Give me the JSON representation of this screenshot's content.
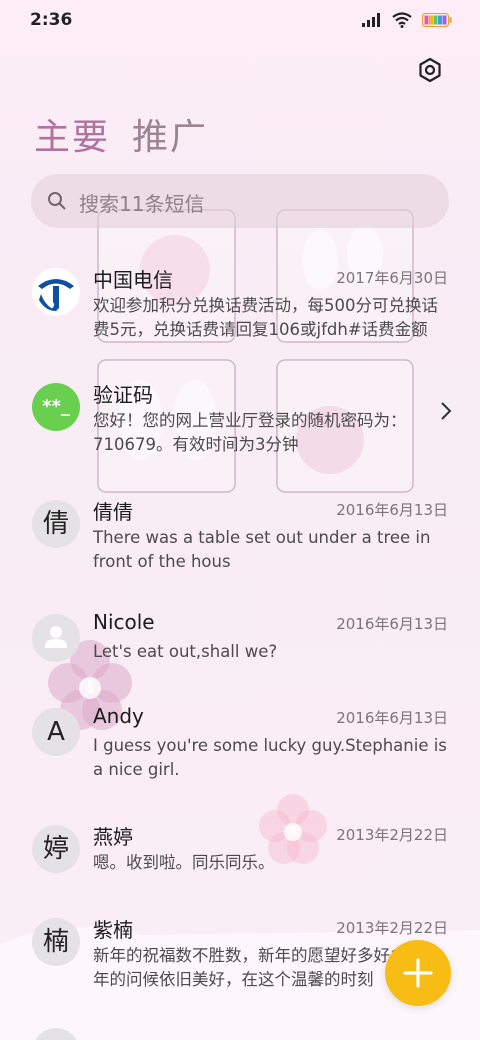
{
  "status_bar": {
    "time": "2:36",
    "icons": [
      "signal-icon",
      "wifi-icon",
      "battery-icon"
    ]
  },
  "header": {
    "settings_icon": "settings-hexagon-icon",
    "tabs": [
      {
        "label": "主要"
      },
      {
        "label": "推广"
      }
    ]
  },
  "search": {
    "placeholder": "搜索11条短信",
    "icon": "search-icon"
  },
  "messages": [
    {
      "sender": "中国电信",
      "avatar": "china-telecom-logo",
      "date": "2017年6月30日",
      "preview": "欢迎参加积分兑换话费活动，每500分可兑换话费5元，兑换话费请回复106或jfdh#话费金额"
    },
    {
      "sender": "验证码",
      "avatar": "**_",
      "date": "",
      "preview": "您好！您的网上营业厅登录的随机密码为：710679。有效时间为3分钟"
    },
    {
      "sender": "倩倩",
      "avatar": "倩",
      "date": "2016年6月13日",
      "preview": "There was a table set out under a tree in front of the hous"
    },
    {
      "sender": "Nicole",
      "avatar": "person-icon",
      "date": "2016年6月13日",
      "preview": "Let's eat out,shall we?"
    },
    {
      "sender": "Andy",
      "avatar": "A",
      "date": "2016年6月13日",
      "preview": "I guess you're some lucky guy.Stephanie is a nice girl."
    },
    {
      "sender": "燕婷",
      "avatar": "婷",
      "date": "2013年2月22日",
      "preview": "嗯。收到啦。同乐同乐。"
    },
    {
      "sender": "紫楠",
      "avatar": "楠",
      "date": "2013年2月22日",
      "preview": "新年的祝福数不胜数，新年的愿望好多好多，新年的问候依旧美好，在这个温馨的时刻"
    }
  ],
  "colors": {
    "tab_active": "#b0739f",
    "fab": "#f8bd14",
    "verify_avatar": "#69cf4f",
    "telecom_blue": "#0d4fa0"
  },
  "fab": {
    "icon": "plus-icon"
  }
}
